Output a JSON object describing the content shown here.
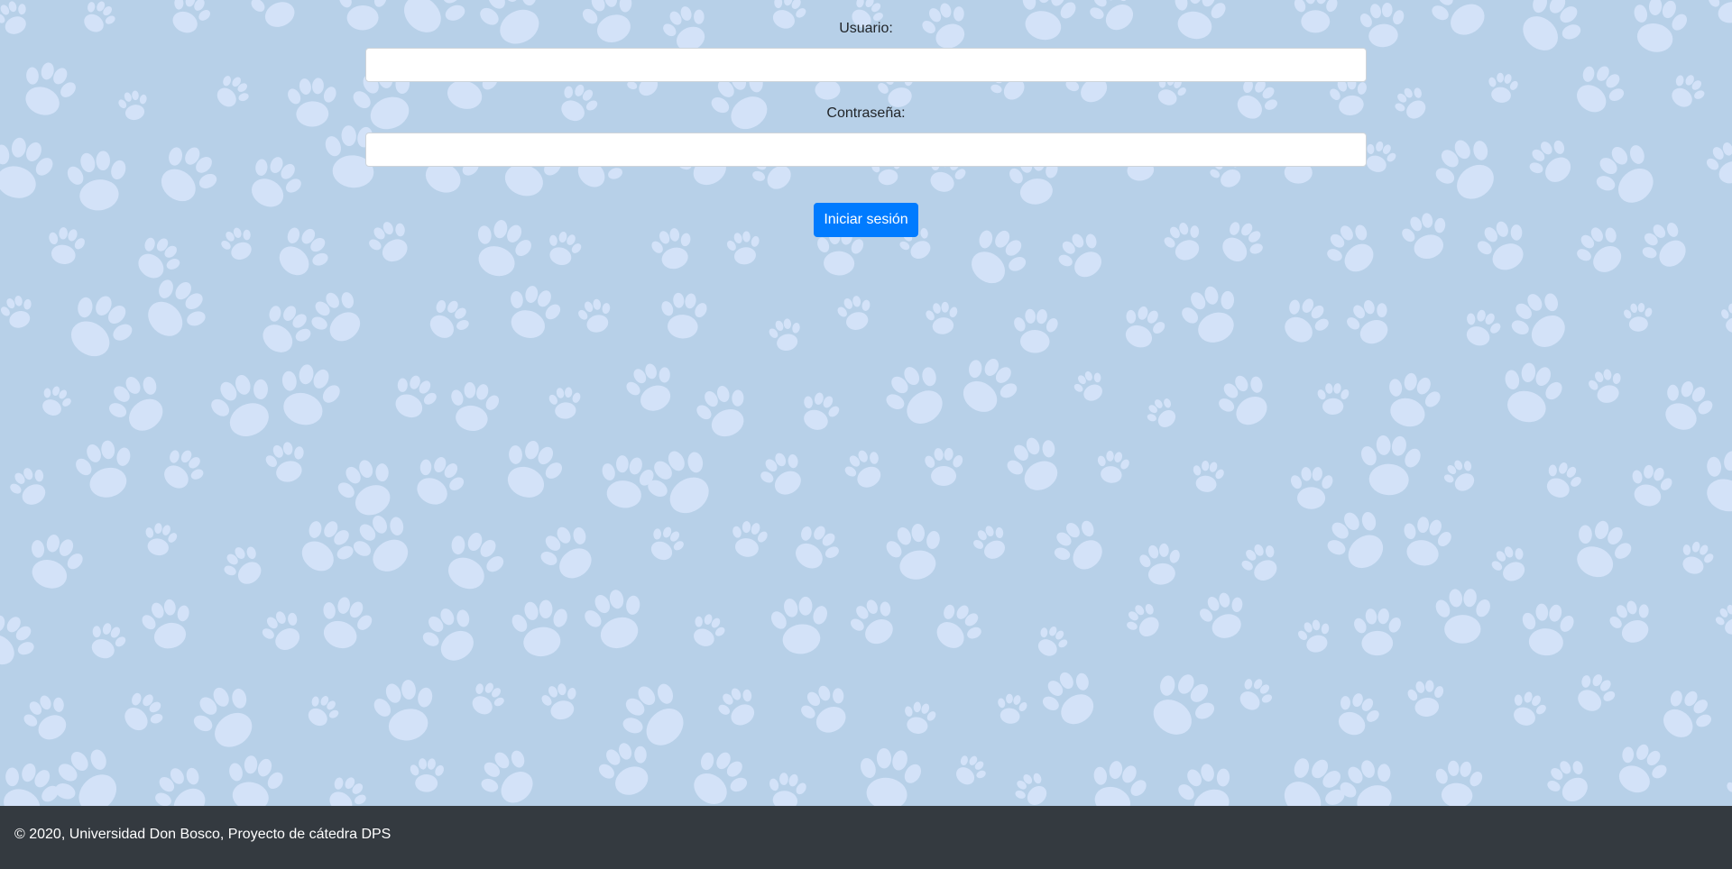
{
  "login": {
    "username_label": "Usuario:",
    "username_value": "",
    "password_label": "Contraseña:",
    "password_value": "",
    "submit_label": "Iniciar sesión"
  },
  "footer": {
    "text": "© 2020, Universidad Don Bosco, Proyecto de cátedra DPS"
  },
  "colors": {
    "background": "#b7d0e8",
    "paw_print": "#d3e2f8",
    "primary_button": "#007bff",
    "footer": "#343a40"
  },
  "icons": {
    "background_pattern": "paw-print-icon"
  }
}
